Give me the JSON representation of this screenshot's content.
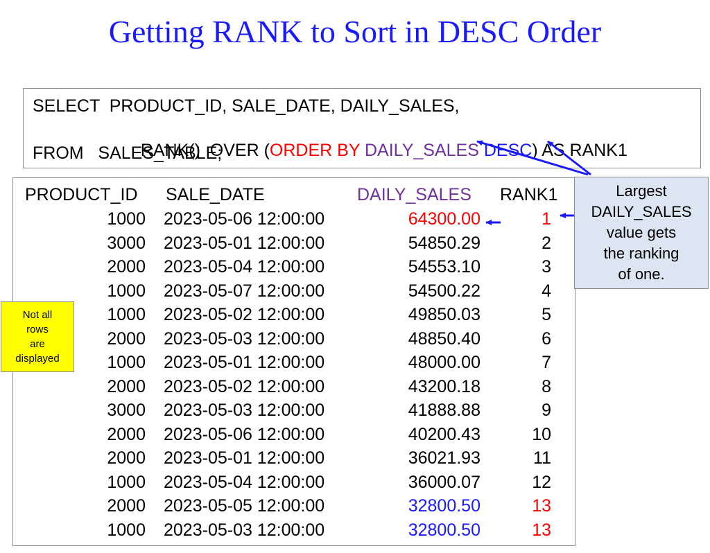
{
  "title": "Getting RANK to Sort in DESC Order",
  "colors": {
    "title": "#1a1aff",
    "keyword_red": "#ff0000",
    "column_purple": "#7030a0",
    "desc_blue": "#1a1aff",
    "tie_blue": "#1a1aff",
    "callout_bg": "#dce6f2",
    "note_bg": "#ffff00",
    "arrow": "#1a1aff"
  },
  "sql": {
    "line1": "SELECT  PRODUCT_ID, SALE_DATE, DAILY_SALES,",
    "line2_pre": "RANK()  OVER (",
    "line2_order_by": "ORDER BY ",
    "line2_daily_sales": "DAILY_SALES ",
    "line2_desc": "DESC",
    "line2_post": ") AS RANK1",
    "line3": "FROM   SALES_TABLE;"
  },
  "table": {
    "headers": {
      "product_id": "PRODUCT_ID",
      "sale_date": "SALE_DATE",
      "daily_sales": "DAILY_SALES",
      "rank1": "RANK1"
    },
    "rows": [
      {
        "product_id": "1000",
        "sale_date": "2023-05-06 12:00:00",
        "daily_sales": "64300.00",
        "rank1": "1",
        "highlight": "top"
      },
      {
        "product_id": "3000",
        "sale_date": "2023-05-01 12:00:00",
        "daily_sales": "54850.29",
        "rank1": "2",
        "highlight": "none"
      },
      {
        "product_id": "2000",
        "sale_date": "2023-05-04 12:00:00",
        "daily_sales": "54553.10",
        "rank1": "3",
        "highlight": "none"
      },
      {
        "product_id": "1000",
        "sale_date": "2023-05-07 12:00:00",
        "daily_sales": "54500.22",
        "rank1": "4",
        "highlight": "none"
      },
      {
        "product_id": "1000",
        "sale_date": "2023-05-02 12:00:00",
        "daily_sales": "49850.03",
        "rank1": "5",
        "highlight": "none"
      },
      {
        "product_id": "2000",
        "sale_date": "2023-05-03 12:00:00",
        "daily_sales": "48850.40",
        "rank1": "6",
        "highlight": "none"
      },
      {
        "product_id": "1000",
        "sale_date": "2023-05-01 12:00:00",
        "daily_sales": "48000.00",
        "rank1": "7",
        "highlight": "none"
      },
      {
        "product_id": "2000",
        "sale_date": "2023-05-02 12:00:00",
        "daily_sales": "43200.18",
        "rank1": "8",
        "highlight": "none"
      },
      {
        "product_id": "3000",
        "sale_date": "2023-05-03 12:00:00",
        "daily_sales": "41888.88",
        "rank1": "9",
        "highlight": "none"
      },
      {
        "product_id": "2000",
        "sale_date": "2023-05-06 12:00:00",
        "daily_sales": "40200.43",
        "rank1": "10",
        "highlight": "none"
      },
      {
        "product_id": "2000",
        "sale_date": "2023-05-01 12:00:00",
        "daily_sales": "36021.93",
        "rank1": "11",
        "highlight": "none"
      },
      {
        "product_id": "1000",
        "sale_date": "2023-05-04 12:00:00",
        "daily_sales": "36000.07",
        "rank1": "12",
        "highlight": "none"
      },
      {
        "product_id": "2000",
        "sale_date": "2023-05-05 12:00:00",
        "daily_sales": "32800.50",
        "rank1": "13",
        "highlight": "tie"
      },
      {
        "product_id": "1000",
        "sale_date": "2023-05-03 12:00:00",
        "daily_sales": "32800.50",
        "rank1": "13",
        "highlight": "tie"
      }
    ]
  },
  "callout": {
    "text": "Largest\nDAILY_SALES\nvalue gets\nthe ranking\nof one."
  },
  "note": {
    "text": "Not all\nrows\nare\ndisplayed"
  }
}
